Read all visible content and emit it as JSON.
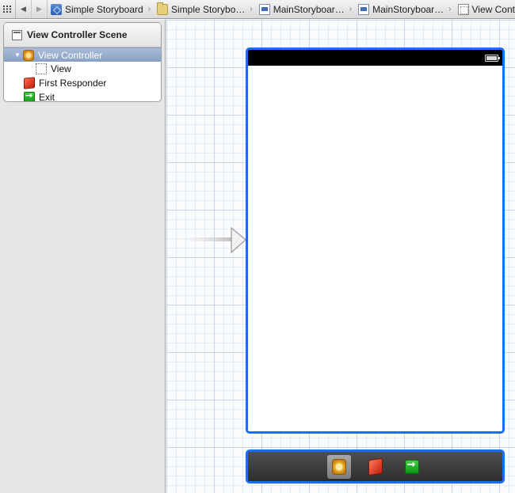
{
  "jump_bar": {
    "grid_icon": "related-items-grid-icon",
    "back_icon": "back-arrow-icon",
    "forward_icon": "forward-arrow-icon",
    "crumbs": [
      {
        "label": "Simple Storyboard",
        "icon": "project-icon"
      },
      {
        "label": "Simple Storybo…",
        "icon": "folder-icon"
      },
      {
        "label": "MainStoryboar…",
        "icon": "storyboard-file-icon"
      },
      {
        "label": "MainStoryboar…",
        "icon": "storyboard-file-icon"
      },
      {
        "label": "View Cont",
        "icon": "view-controller-icon"
      }
    ],
    "separator": "›"
  },
  "outline": {
    "scene_title": "View Controller Scene",
    "scene_icon": "scene-icon",
    "items": [
      {
        "label": "View Controller",
        "icon": "view-controller-icon",
        "selected": true,
        "expanded": true,
        "disclosure": "▼"
      },
      {
        "label": "View",
        "icon": "view-icon",
        "selected": false
      },
      {
        "label": "First Responder",
        "icon": "first-responder-icon",
        "selected": false
      },
      {
        "label": "Exit",
        "icon": "exit-icon",
        "selected": false
      }
    ]
  },
  "canvas": {
    "entry_arrow_icon": "storyboard-entry-arrow-icon",
    "status_bar": {
      "battery_icon": "battery-icon"
    },
    "scene_dock": {
      "items": [
        {
          "icon": "view-controller-icon",
          "active": true
        },
        {
          "icon": "first-responder-icon",
          "active": false
        },
        {
          "icon": "exit-icon",
          "active": false
        }
      ]
    }
  },
  "colors": {
    "selection_blue": "#1a6ef5",
    "outline_selected": "#8aa1c7",
    "dock_background": "#3a3a3a"
  }
}
